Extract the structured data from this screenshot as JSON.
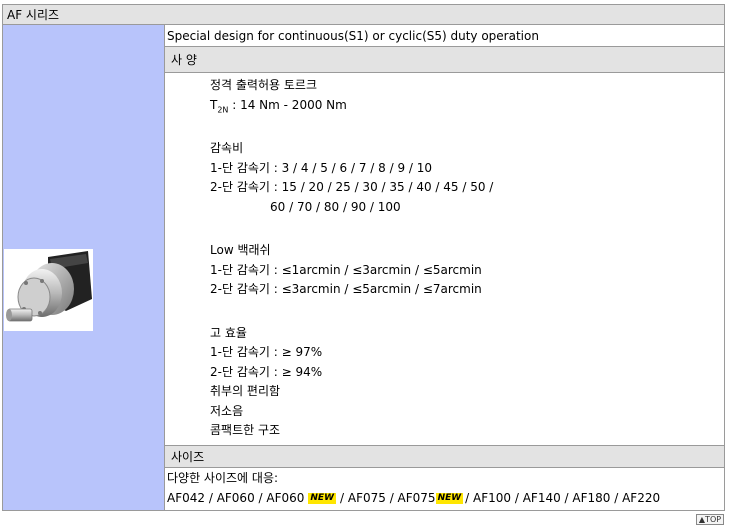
{
  "series_title": "AF 시리즈",
  "description": "Special design for continuous(S1) or cyclic(S5) duty operation",
  "spec_header": "사 양",
  "specs": {
    "torque_label": "정격 출력허용 토르크",
    "torque_symbol": "T",
    "torque_sub": "2N",
    "torque_value": " : 14 Nm - 2000 Nm",
    "ratio_label": "감속비",
    "ratio_1stage": "1-단 감속기 : 3 / 4 / 5 / 6 / 7 / 8 / 9 / 10",
    "ratio_2stage": "2-단 감속기 : 15 / 20 / 25 / 30 / 35 / 40 / 45 / 50 /",
    "ratio_2stage_cont": "60 / 70 / 80 / 90 / 100",
    "backlash_label": "Low 백래쉬",
    "backlash_1stage": "1-단 감속기 : ≤1arcmin / ≤3arcmin / ≤5arcmin",
    "backlash_2stage": "2-단 감속기 : ≤3arcmin / ≤5arcmin / ≤7arcmin",
    "efficiency_label": "고 효율",
    "efficiency_1stage": "1-단 감속기 : ≥ 97%",
    "efficiency_2stage": "2-단 감속기 : ≥ 94%",
    "feature_install": "취부의 편리함",
    "feature_noise": "저소음",
    "feature_compact": "콤팩트한 구조"
  },
  "size_header": "사이즈",
  "size_intro": "다양한 사이즈에 대응:",
  "sizes": {
    "s1": "AF042 / AF060 / AF060",
    "s2": "/ AF075  / AF075",
    "s3": "/ AF100 / AF140 / AF180 / AF220",
    "new_badge": "NEW"
  },
  "top_button": "▲TOP"
}
